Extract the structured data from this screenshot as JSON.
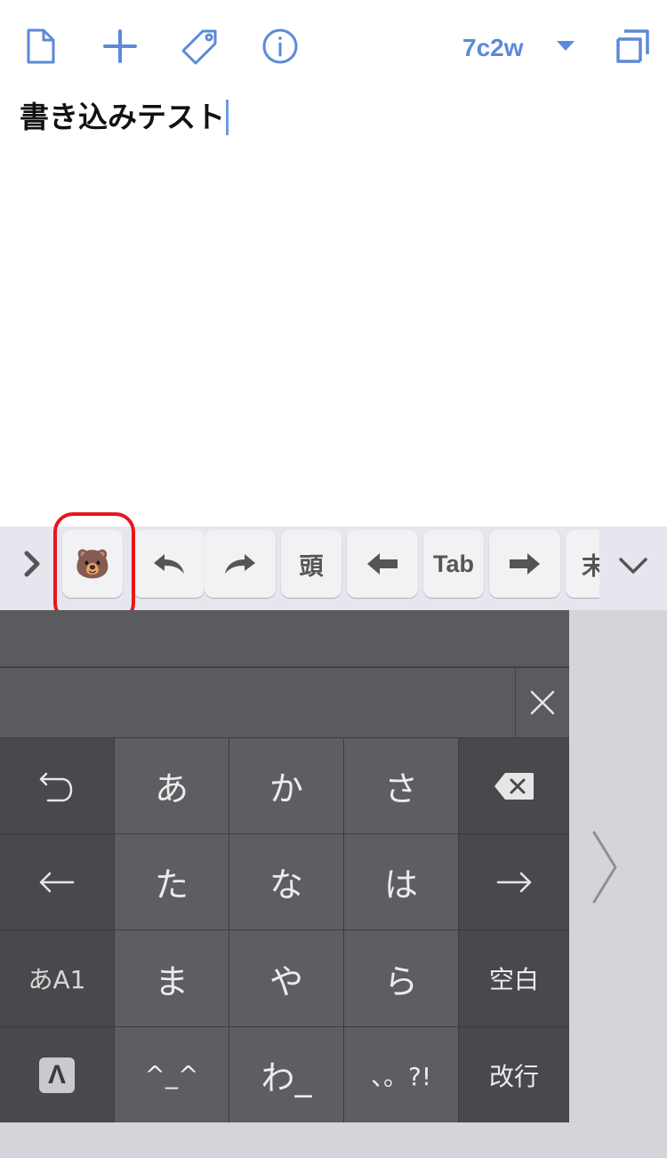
{
  "toolbar": {
    "icons": [
      "new-document-icon",
      "plus-icon",
      "tag-icon",
      "info-icon",
      "caret-down-icon",
      "window-icon"
    ],
    "doc_id": "7c2w",
    "accent": "#5b8ad8"
  },
  "editor": {
    "text": "書き込みテスト"
  },
  "accessory_bar": {
    "keys": [
      {
        "name": "bear-emoji",
        "label": "🐻"
      },
      {
        "name": "undo",
        "label": ""
      },
      {
        "name": "redo",
        "label": ""
      },
      {
        "name": "line-head",
        "label": "頭"
      },
      {
        "name": "arrow-left",
        "label": ""
      },
      {
        "name": "tab",
        "label": "Tab"
      },
      {
        "name": "arrow-right",
        "label": ""
      },
      {
        "name": "line-end",
        "label": "末"
      }
    ],
    "highlight_color": "#e8161c"
  },
  "keyboard": {
    "rows": [
      [
        "↺",
        "あ",
        "か",
        "さ",
        "⌫"
      ],
      [
        "←",
        "た",
        "な",
        "は",
        "→"
      ],
      [
        "あA1",
        "ま",
        "や",
        "ら",
        "空白"
      ],
      [
        "Λ",
        "^_^",
        "わ_",
        "、。?!",
        "改行"
      ]
    ]
  }
}
